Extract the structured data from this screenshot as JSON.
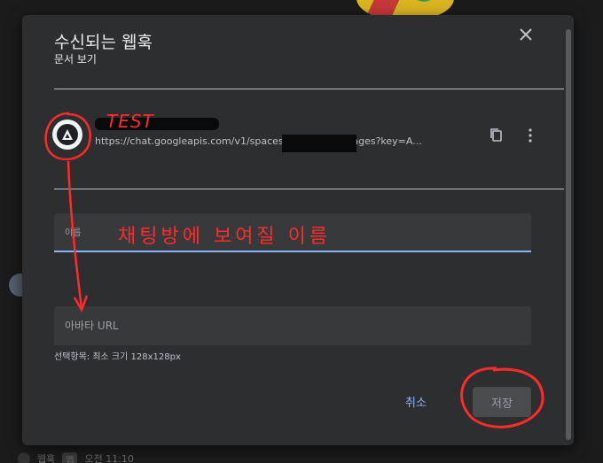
{
  "background": {
    "footer": {
      "name": "웹훅",
      "tag": "앱",
      "time": "오전 11:10"
    }
  },
  "dialog": {
    "title": "수신되는 웹훅",
    "subtitle": "문서 보기",
    "close_icon": "close-icon"
  },
  "webhook": {
    "name": "TEST",
    "url": "https://chat.googleapis.com/v1/spaces/AAAAV      /messages?key=A...",
    "copy_icon": "copy-icon",
    "more_icon": "more-vert-icon"
  },
  "form": {
    "name_placeholder": "이름",
    "avatar_placeholder": "아바타 URL",
    "avatar_hint": "선택항목: 최소 크기 128x128px"
  },
  "actions": {
    "cancel_label": "취소",
    "save_label": "저장"
  },
  "annotations": {
    "test_label": "TEST",
    "name_note": "채팅방에 보여질 이름",
    "color": "#ff2a2a"
  },
  "colors": {
    "accent": "#8ab4f8",
    "dialog_bg": "#2d2e30",
    "field_bg": "#38393b"
  }
}
